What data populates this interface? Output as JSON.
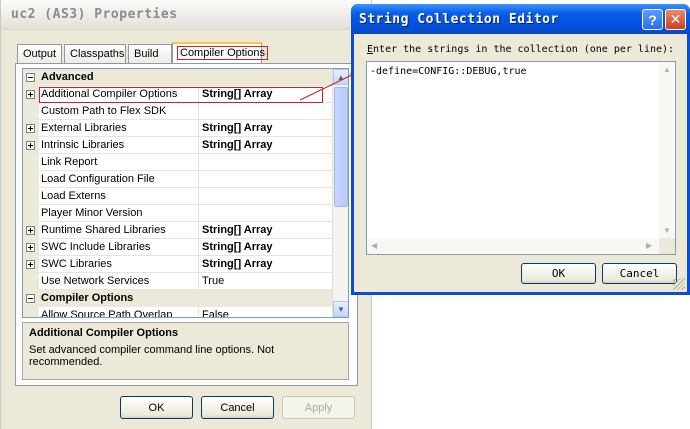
{
  "properties_window": {
    "title": "uc2 (AS3) Properties",
    "tabs": [
      {
        "label": "Output",
        "active": false
      },
      {
        "label": "Classpaths",
        "active": false
      },
      {
        "label": "Build",
        "active": false
      },
      {
        "label": "Compiler Options",
        "active": true
      }
    ],
    "grid": {
      "categories": {
        "advanced": "Advanced",
        "compiler": "Compiler Options"
      },
      "rows": [
        {
          "name": "Additional Compiler Options",
          "value": "String[] Array",
          "expandable": true,
          "selected": true
        },
        {
          "name": "Custom Path to Flex SDK",
          "value": "",
          "expandable": false
        },
        {
          "name": "External Libraries",
          "value": "String[] Array",
          "expandable": true
        },
        {
          "name": "Intrinsic Libraries",
          "value": "String[] Array",
          "expandable": true
        },
        {
          "name": "Link Report",
          "value": "",
          "expandable": false
        },
        {
          "name": "Load Configuration File",
          "value": "",
          "expandable": false
        },
        {
          "name": "Load Externs",
          "value": "",
          "expandable": false
        },
        {
          "name": "Player Minor Version",
          "value": "",
          "expandable": false
        },
        {
          "name": "Runtime Shared Libraries",
          "value": "String[] Array",
          "expandable": true
        },
        {
          "name": "SWC Include Libraries",
          "value": "String[] Array",
          "expandable": true
        },
        {
          "name": "SWC Libraries",
          "value": "String[] Array",
          "expandable": true
        },
        {
          "name": "Use Network Services",
          "value": "True",
          "expandable": false
        }
      ],
      "compiler_rows": [
        {
          "name": "Allow Source Path Overlap",
          "value": "False",
          "expandable": false
        }
      ]
    },
    "description": {
      "title": "Additional Compiler Options",
      "text": "Set advanced compiler command line options. Not recommended."
    },
    "buttons": {
      "ok": "OK",
      "cancel": "Cancel",
      "apply": "Apply"
    }
  },
  "string_editor": {
    "title": "String Collection Editor",
    "help_glyph": "?",
    "close_glyph": "✕",
    "prompt_underlined": "E",
    "prompt_rest": "nter the strings in the collection (one per line):",
    "lines": [
      "-define=CONFIG::DEBUG,true"
    ],
    "buttons": {
      "ok": "OK",
      "cancel": "Cancel"
    }
  },
  "colors": {
    "highlight": "#d42020",
    "titlebar_active": "#0054e3",
    "window_face": "#ece9d8"
  }
}
